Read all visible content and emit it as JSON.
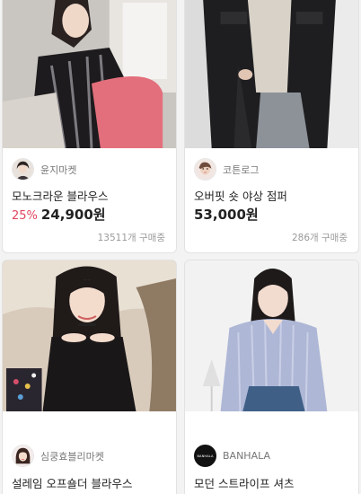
{
  "products": [
    {
      "seller": "윤지마켓",
      "title": "모노크라운 블라우스",
      "discount": "25%",
      "price": "24,900원",
      "sold": "13511개 구매중"
    },
    {
      "seller": "코튼로그",
      "title": "오버핏 숏 야상 점퍼",
      "discount": "",
      "price": "53,000원",
      "sold": "286개 구매중"
    },
    {
      "seller": "심쿵효블리마켓",
      "title": "설레임 오프숄더 블라우스"
    },
    {
      "seller": "BANHALA",
      "avatar_text": "BANHALA",
      "title": "모던 스트라이프 셔츠"
    }
  ],
  "colors": {
    "discount": "#e0445f",
    "card_border": "#e2e2e2",
    "muted": "#9a9a9a"
  }
}
